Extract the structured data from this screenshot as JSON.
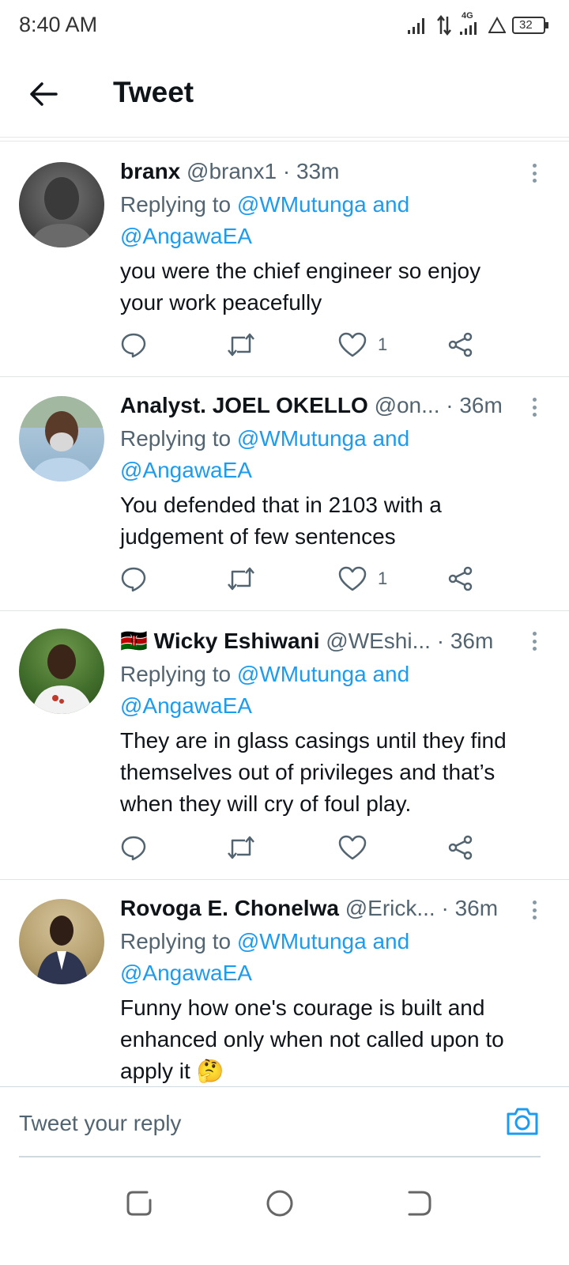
{
  "status": {
    "time": "8:40 AM",
    "network": "4G",
    "battery": "32"
  },
  "header": {
    "title": "Tweet",
    "back_icon": "arrow-left-icon"
  },
  "tweets": [
    {
      "name": "branx",
      "handle": "@branx1",
      "sep": "·",
      "time": "33m",
      "replying_prefix": "Replying to",
      "mention1": "@WMutunga and",
      "mention2": "@AngawaEA",
      "text": "you were the chief engineer so enjoy your work peacefully",
      "like_count": "1"
    },
    {
      "name": "Analyst. JOEL OKELLO",
      "handle": "@on...",
      "sep": "·",
      "time": "36m",
      "replying_prefix": "Replying to",
      "mention1": "@WMutunga and",
      "mention2": "@AngawaEA",
      "text": "You defended that in 2103 with a judgement of few sentences",
      "like_count": "1"
    },
    {
      "flag": "🇰🇪",
      "name": "Wicky Eshiwani",
      "handle": "@WEshi...",
      "sep": "·",
      "time": "36m",
      "replying_prefix": "Replying to",
      "mention1": "@WMutunga and",
      "mention2": "@AngawaEA",
      "text": "They are in glass casings until they find themselves out of privileges and that’s when they will cry of foul play.",
      "like_count": ""
    },
    {
      "name": "Rovoga E. Chonelwa",
      "handle": "@Erick...",
      "sep": "·",
      "time": "36m",
      "replying_prefix": "Replying to",
      "mention1": "@WMutunga and",
      "mention2": "@AngawaEA",
      "text": "Funny how one's courage is built and enhanced only when not called upon to apply it 🤔",
      "like_count": ""
    }
  ],
  "reply": {
    "placeholder": "Tweet your reply"
  },
  "colors": {
    "accent": "#1d9bf0",
    "secondary_text": "#536471",
    "primary_text": "#0f1419"
  }
}
